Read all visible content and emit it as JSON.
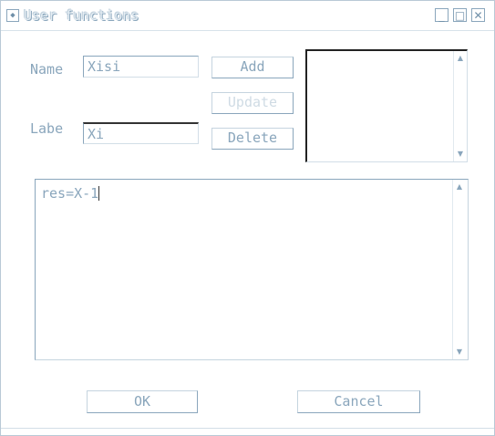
{
  "window": {
    "title": "User functions",
    "icon": "app-icon",
    "controls": {
      "minimize": "_",
      "maximize": "□",
      "close": "✕"
    }
  },
  "form": {
    "name_label": "Name",
    "name_value": "Xisi",
    "label_label": "Labe",
    "label_value": "Xi"
  },
  "buttons": {
    "add": "Add",
    "update": "Update",
    "delete": "Delete",
    "ok": "OK",
    "cancel": "Cancel"
  },
  "function_list": {
    "items": [],
    "scroll_up": "▲",
    "scroll_down": "▼"
  },
  "editor": {
    "text": "res=X-1",
    "scroll_up": "▲",
    "scroll_down": "▼"
  },
  "colors": {
    "text": "#8aa6bc",
    "border": "#8aa6bc",
    "disabled": "#cfdbe4"
  }
}
